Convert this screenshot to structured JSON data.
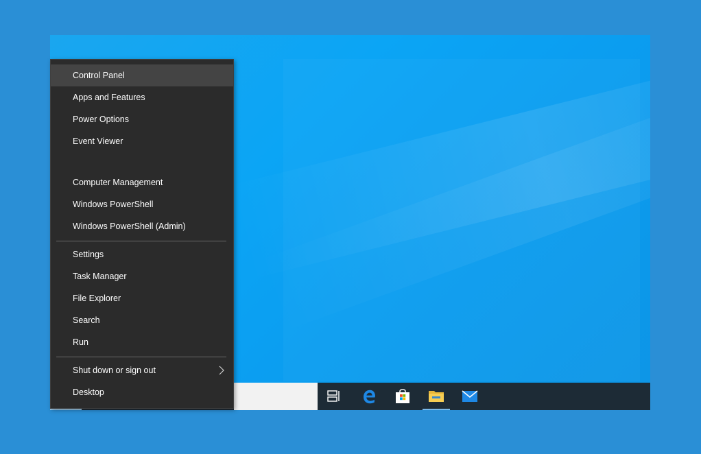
{
  "context_menu": {
    "items": [
      {
        "label": "Control Panel"
      },
      {
        "label": "Apps and Features"
      },
      {
        "label": "Power Options"
      },
      {
        "label": "Event Viewer"
      },
      {
        "label": "Computer Management"
      },
      {
        "label": "Windows PowerShell"
      },
      {
        "label": "Windows PowerShell (Admin)"
      },
      {
        "label": "Settings"
      },
      {
        "label": "Task Manager"
      },
      {
        "label": "File Explorer"
      },
      {
        "label": "Search"
      },
      {
        "label": "Run"
      },
      {
        "label": "Shut down or sign out"
      },
      {
        "label": "Desktop"
      }
    ],
    "highlighted_item": "Control Panel"
  },
  "taskbar": {
    "icons": [
      "task-view-icon",
      "edge-icon",
      "store-icon",
      "file-explorer-icon",
      "mail-icon"
    ],
    "active_icon": "file-explorer-icon"
  },
  "colors": {
    "menu_background": "#2b2b2b",
    "menu_hover": "#444444",
    "desktop_blue": "#0ba5f5",
    "taskbar": "#1d2b36",
    "page_background": "#2a8fd6"
  }
}
